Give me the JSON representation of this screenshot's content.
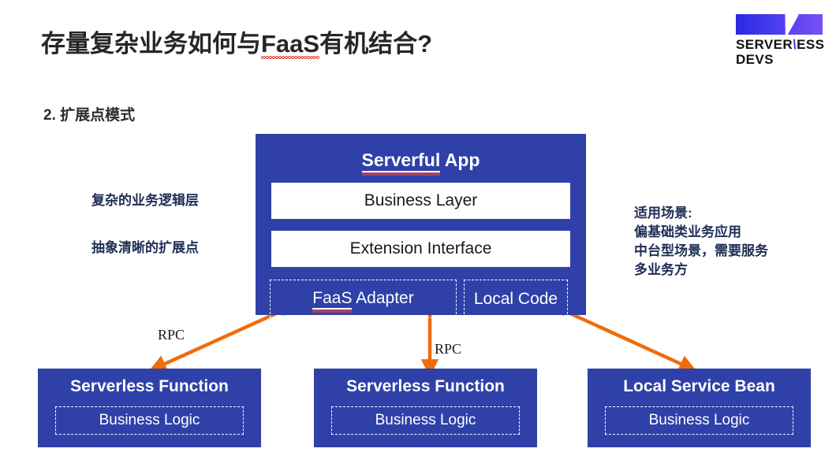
{
  "slide": {
    "title_prefix": "存量复杂业务如何与",
    "title_spellword": "FaaS",
    "title_suffix": "有机结合?",
    "section_label": "2. 扩展点模式"
  },
  "logo": {
    "line1_before": "SERVER",
    "line1_slash": "\\",
    "line1_after": "ESS",
    "line2": "DEVS",
    "gradient_start": "#2a2ae0",
    "gradient_end": "#7b4ff5"
  },
  "serverful": {
    "title_spellword": "Serverful",
    "title_rest": " App",
    "layers": [
      {
        "label": "Business Layer"
      },
      {
        "label": "Extension Interface"
      }
    ],
    "adapters": [
      {
        "spellword": "FaaS",
        "rest": " Adapter"
      },
      {
        "label": "Local Code"
      }
    ]
  },
  "annotations": {
    "left_top": "复杂的业务逻辑层",
    "left_bottom": "抽象清晰的扩展点",
    "right_lines": [
      "适用场景:",
      "偏基础类业务应用",
      "中台型场景，需要服务",
      "多业务方"
    ]
  },
  "connectors": {
    "rpc_left_label": "RPC",
    "rpc_middle_label": "RPC",
    "arrow_color": "#ef6c0b"
  },
  "bottom_boxes": [
    {
      "title": "Serverless Function",
      "sub": "Business Logic"
    },
    {
      "title": "Serverless Function",
      "sub": "Business Logic"
    },
    {
      "title": "Local Service Bean",
      "sub": "Business Logic"
    }
  ],
  "colors": {
    "box_blue": "#2f41a8",
    "note_navy": "#1f2d56",
    "spell_red": "#e8443a"
  }
}
